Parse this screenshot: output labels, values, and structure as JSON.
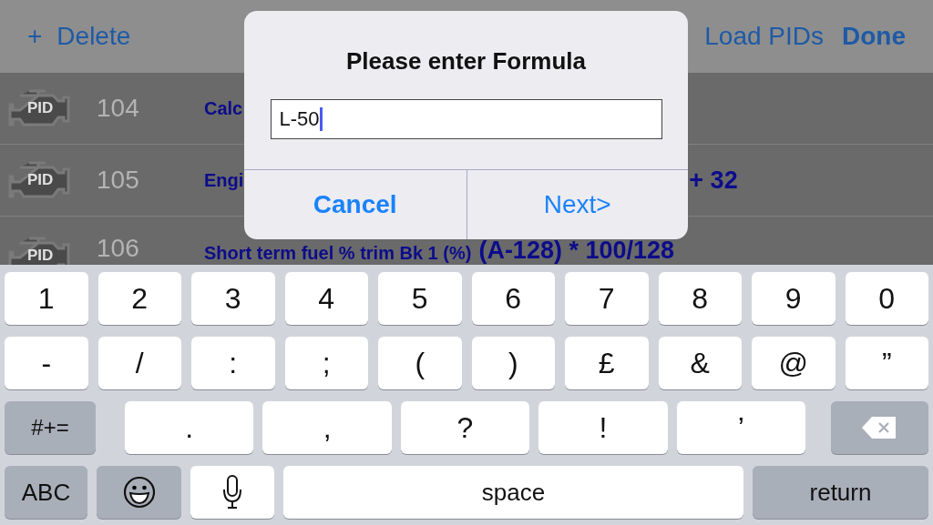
{
  "nav": {
    "add": "+",
    "delete": "Delete",
    "load": "Load PIDs",
    "done": "Done"
  },
  "rows": [
    {
      "badge": "PID",
      "number": "104",
      "name": "Calc",
      "formula": ""
    },
    {
      "badge": "PID",
      "number": "105",
      "name": "Engi",
      "formula": "+ 32"
    },
    {
      "badge": "PID",
      "number": "106",
      "name": "Short term fuel % trim Bk 1 (%)",
      "formula": "(A-128) * 100/128"
    }
  ],
  "dialog": {
    "title": "Please enter Formula",
    "value": "L-50",
    "buttons": [
      {
        "label": "Cancel",
        "kind": "cancel"
      },
      {
        "label": "Next>",
        "kind": "default"
      }
    ]
  },
  "keyboard": [
    [
      {
        "label": "1",
        "kind": "char"
      },
      {
        "label": "2",
        "kind": "char"
      },
      {
        "label": "3",
        "kind": "char"
      },
      {
        "label": "4",
        "kind": "char"
      },
      {
        "label": "5",
        "kind": "char"
      },
      {
        "label": "6",
        "kind": "char"
      },
      {
        "label": "7",
        "kind": "char"
      },
      {
        "label": "8",
        "kind": "char"
      },
      {
        "label": "9",
        "kind": "char"
      },
      {
        "label": "0",
        "kind": "char"
      }
    ],
    [
      {
        "label": "-",
        "kind": "char"
      },
      {
        "label": "/",
        "kind": "char"
      },
      {
        "label": ":",
        "kind": "char"
      },
      {
        "label": ";",
        "kind": "char"
      },
      {
        "label": "(",
        "kind": "char"
      },
      {
        "label": ")",
        "kind": "char"
      },
      {
        "label": "£",
        "kind": "char"
      },
      {
        "label": "&",
        "kind": "char"
      },
      {
        "label": "@",
        "kind": "char"
      },
      {
        "label": "”",
        "kind": "char"
      }
    ],
    [
      {
        "label": "#+=",
        "kind": "function"
      },
      {
        "label": ".",
        "kind": "char"
      },
      {
        "label": ",",
        "kind": "char"
      },
      {
        "label": "?",
        "kind": "char"
      },
      {
        "label": "!",
        "kind": "char"
      },
      {
        "label": "’",
        "kind": "char"
      },
      {
        "kind": "backspace"
      }
    ],
    [
      {
        "label": "ABC",
        "kind": "function"
      },
      {
        "kind": "emoji"
      },
      {
        "kind": "mic"
      },
      {
        "label": "space",
        "kind": "char"
      },
      {
        "label": "return",
        "kind": "function"
      }
    ]
  ]
}
